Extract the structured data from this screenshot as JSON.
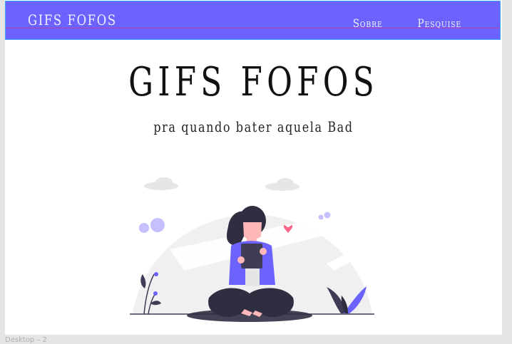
{
  "navbar": {
    "brand": "GIFS FOFOS",
    "links": [
      "Sobre",
      "Pesquise"
    ]
  },
  "hero": {
    "title": "GIFS FOFOS",
    "subtitle": "pra quando bater aquela Bad"
  },
  "artboard_label": "Desktop – 2",
  "colors": {
    "accent": "#6c63ff",
    "heart": "#ff6584",
    "dark": "#2f2e41",
    "background_shape": "#f2f2f2"
  },
  "icons": [
    "heart-icon",
    "cloud-icon",
    "plant-icon"
  ]
}
